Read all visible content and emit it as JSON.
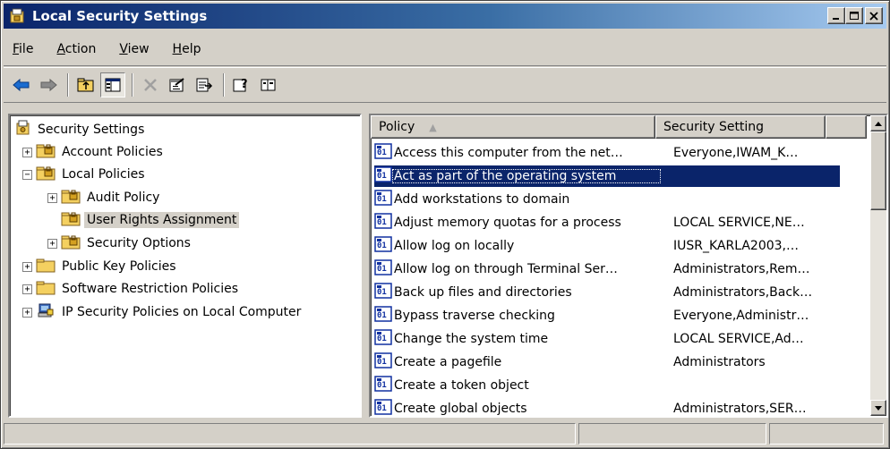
{
  "window": {
    "title": "Local Security Settings",
    "controls": {
      "minimize": "_",
      "maximize": "□",
      "close": "x"
    }
  },
  "menu": [
    {
      "label": "File",
      "accel": "F",
      "rest": "ile"
    },
    {
      "label": "Action",
      "accel": "A",
      "rest": "ction"
    },
    {
      "label": "View",
      "accel": "V",
      "rest": "iew"
    },
    {
      "label": "Help",
      "accel": "H",
      "rest": "elp"
    }
  ],
  "toolbar": {
    "buttons": [
      "back-icon",
      "forward-icon",
      "up-folder-icon",
      "show-hide-tree-icon",
      "delete-icon",
      "properties-icon",
      "export-list-icon",
      "help-icon",
      "console-icon"
    ]
  },
  "tree": [
    {
      "label": "Security Settings",
      "icon": "security-settings-icon",
      "expander": ""
    },
    {
      "label": "Account Policies",
      "icon": "policy-folder-icon",
      "expander": "+"
    },
    {
      "label": "Local Policies",
      "icon": "policy-folder-icon",
      "expander": "−"
    },
    {
      "label": "Audit Policy",
      "icon": "policy-folder-icon",
      "expander": "+"
    },
    {
      "label": "User Rights Assignment",
      "icon": "policy-folder-icon",
      "expander": ""
    },
    {
      "label": "Security Options",
      "icon": "policy-folder-icon",
      "expander": "+"
    },
    {
      "label": "Public Key Policies",
      "icon": "folder-icon",
      "expander": "+"
    },
    {
      "label": "Software Restriction Policies",
      "icon": "folder-icon",
      "expander": "+"
    },
    {
      "label": "IP Security Policies on Local Computer",
      "icon": "ip-security-icon",
      "expander": "+"
    }
  ],
  "list": {
    "columns": [
      "Policy",
      "Security Setting"
    ],
    "sort_indicator": "▲",
    "rows": [
      {
        "policy": "Access this computer from the net…",
        "setting": "Everyone,IWAM_K…"
      },
      {
        "policy": "Act as part of the operating system",
        "setting": ""
      },
      {
        "policy": "Add workstations to domain",
        "setting": ""
      },
      {
        "policy": "Adjust memory quotas for a process",
        "setting": "LOCAL SERVICE,NE…"
      },
      {
        "policy": "Allow log on locally",
        "setting": "IUSR_KARLA2003,…"
      },
      {
        "policy": "Allow log on through Terminal Ser…",
        "setting": "Administrators,Rem…"
      },
      {
        "policy": "Back up files and directories",
        "setting": "Administrators,Back…"
      },
      {
        "policy": "Bypass traverse checking",
        "setting": "Everyone,Administr…"
      },
      {
        "policy": "Change the system time",
        "setting": "LOCAL SERVICE,Ad…"
      },
      {
        "policy": "Create a pagefile",
        "setting": "Administrators"
      },
      {
        "policy": "Create a token object",
        "setting": ""
      },
      {
        "policy": "Create global objects",
        "setting": "Administrators,SER…"
      }
    ]
  },
  "colors": {
    "title_start": "#0a246a",
    "title_end": "#a6caf0",
    "selection": "#0a246a",
    "face": "#d4d0c8"
  }
}
